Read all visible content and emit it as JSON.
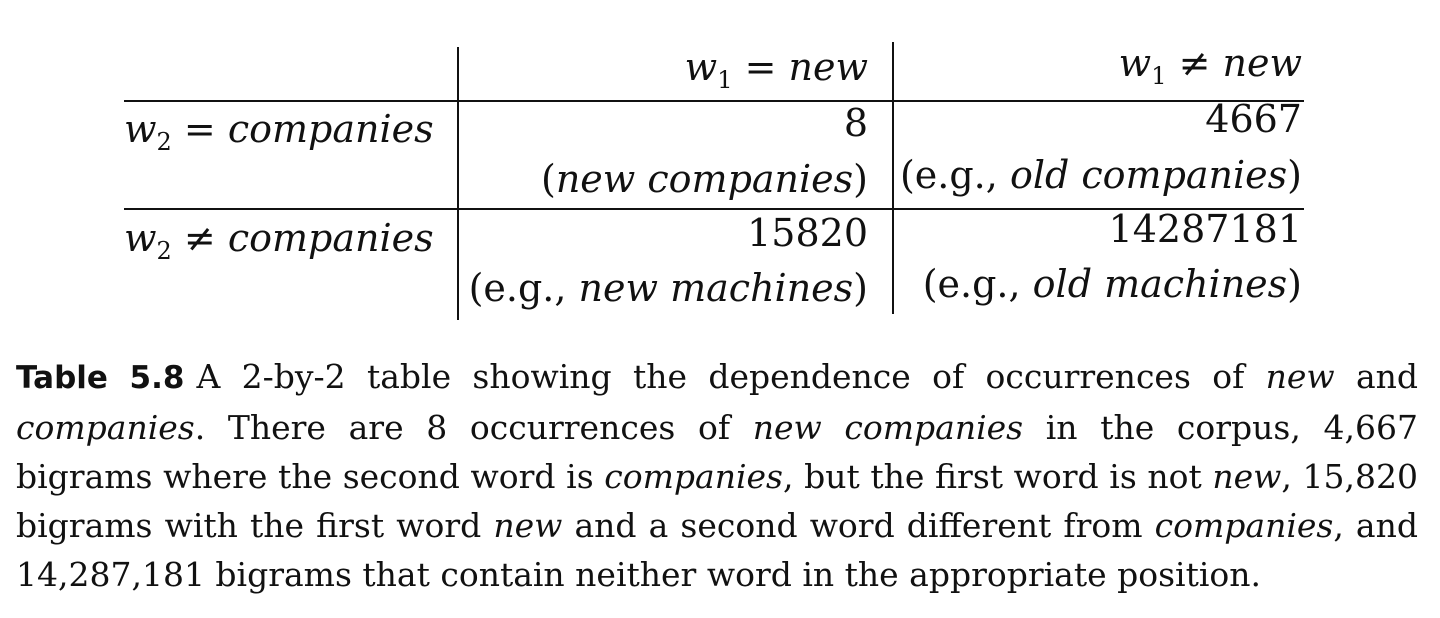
{
  "table": {
    "col_headers": [
      {
        "var": "w",
        "sub": "1",
        "op": "=",
        "word": "new"
      },
      {
        "var": "w",
        "sub": "1",
        "op": "≠",
        "word": "new"
      }
    ],
    "row_headers": [
      {
        "var": "w",
        "sub": "2",
        "op": "=",
        "word": "companies"
      },
      {
        "var": "w",
        "sub": "2",
        "op": "≠",
        "word": "companies"
      }
    ],
    "cells": [
      {
        "count": "8",
        "prefix": "(",
        "phrase": "new companies",
        "suffix": ")"
      },
      {
        "count": "4667",
        "prefix": "(e.g., ",
        "phrase": "old companies",
        "suffix": ")"
      },
      {
        "count": "15820",
        "prefix": "(e.g., ",
        "phrase": "new machines",
        "suffix": ")"
      },
      {
        "count": "14287181",
        "prefix": "(e.g., ",
        "phrase": "old machines",
        "suffix": ")"
      }
    ]
  },
  "caption": {
    "label": "Table 5.8",
    "segments": [
      {
        "t": "A 2-by-2 table showing the dependence of occurrences of ",
        "i": false
      },
      {
        "t": "new",
        "i": true
      },
      {
        "t": " and ",
        "i": false
      },
      {
        "t": "companies",
        "i": true
      },
      {
        "t": ". There are 8 occurrences of ",
        "i": false
      },
      {
        "t": "new companies",
        "i": true
      },
      {
        "t": " in the corpus, 4,667 bigrams where the second word is ",
        "i": false
      },
      {
        "t": "companies",
        "i": true
      },
      {
        "t": ", but the first word is not ",
        "i": false
      },
      {
        "t": "new",
        "i": true
      },
      {
        "t": ", 15,820 bigrams with the first word ",
        "i": false
      },
      {
        "t": "new",
        "i": true
      },
      {
        "t": " and a second word different from ",
        "i": false
      },
      {
        "t": "companies",
        "i": true
      },
      {
        "t": ", and 14,287,181 bigrams that contain neither word in the appropriate position.",
        "i": false
      }
    ]
  }
}
